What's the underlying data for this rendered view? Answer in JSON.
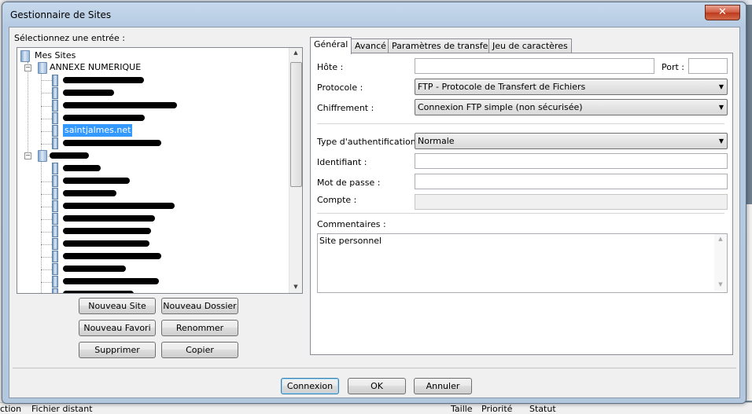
{
  "background": {
    "columns": [
      "ction",
      "Fichier distant",
      "Taille",
      "Priorité",
      "Statut"
    ]
  },
  "window": {
    "title": "Gestionnaire de Sites",
    "close_glyph": "✕"
  },
  "left": {
    "select_label": "Sélectionnez une entrée :",
    "tree": {
      "root": "Mes Sites",
      "folder1": "ANNEXE NUMERIQUE",
      "selected_site": "saintjalmes.net"
    }
  },
  "buttons": {
    "new_site": "Nouveau Site",
    "new_folder": "Nouveau Dossier",
    "new_bookmark": "Nouveau Favori",
    "rename": "Renommer",
    "delete": "Supprimer",
    "copy": "Copier"
  },
  "tabs": [
    "Général",
    "Avancé",
    "Paramètres de transfert",
    "Jeu de caractères"
  ],
  "general": {
    "host_label": "Hôte :",
    "host_value": "",
    "port_label": "Port :",
    "port_value": "",
    "protocol_label": "Protocole :",
    "protocol_value": "FTP - Protocole de Transfert de Fichiers",
    "encryption_label": "Chiffrement :",
    "encryption_value": "Connexion FTP simple (non sécurisée)",
    "auth_type_label": "Type d'authentification :",
    "auth_type_value": "Normale",
    "user_label": "Identifiant :",
    "user_value": "",
    "password_label": "Mot de passe :",
    "password_value": "",
    "account_label": "Compte :",
    "account_value": "",
    "comments_label": "Commentaires :",
    "comments_value": "Site personnel"
  },
  "footer": {
    "connect": "Connexion",
    "ok": "OK",
    "cancel": "Annuler"
  }
}
